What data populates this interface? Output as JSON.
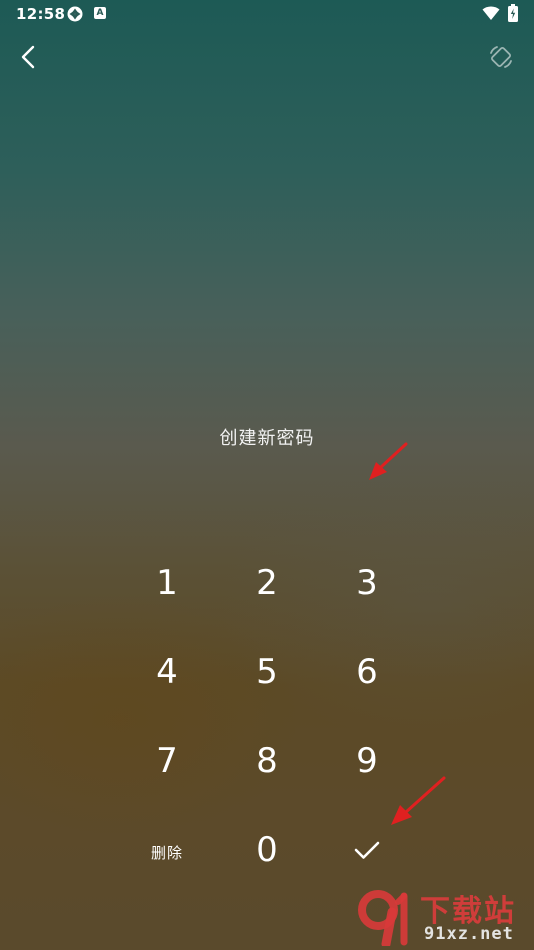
{
  "status_bar": {
    "time": "12:58",
    "icons": [
      "sync-icon",
      "accessibility-a-icon",
      "wifi-icon",
      "battery-charging-icon"
    ],
    "a_badge": "A"
  },
  "toolbar": {
    "back_icon": "chevron-left-icon",
    "rotate_icon": "screen-rotate-icon"
  },
  "prompt": "创建新密码",
  "keypad": {
    "keys": [
      "1",
      "2",
      "3",
      "4",
      "5",
      "6",
      "7",
      "8",
      "9"
    ],
    "delete_label": "删除",
    "zero": "0",
    "confirm_icon": "check-icon"
  },
  "annotations": {
    "arrow_color": "#e02020"
  },
  "watermark": {
    "title": "下载站",
    "domain": "91xz.net",
    "logo_color": "#d93a3a"
  },
  "colors": {
    "text": "#ffffff",
    "bg_top": "#1d5a55",
    "bg_bottom": "#5c4a26"
  }
}
